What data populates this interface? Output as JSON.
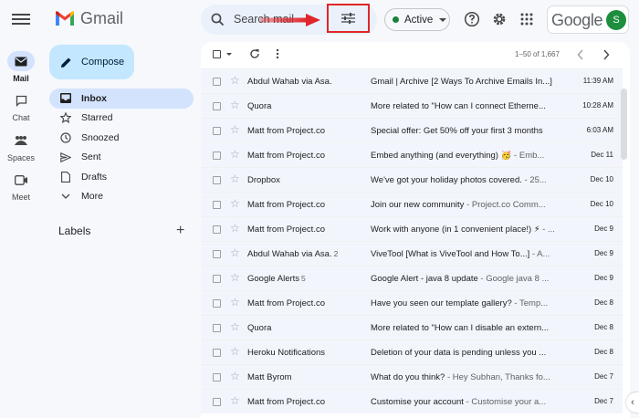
{
  "app": {
    "logo_text": "Gmail"
  },
  "rail": {
    "items": [
      {
        "label": "Mail",
        "icon": "mail-icon",
        "active": true
      },
      {
        "label": "Chat",
        "icon": "chat-icon",
        "active": false
      },
      {
        "label": "Spaces",
        "icon": "spaces-icon",
        "active": false
      },
      {
        "label": "Meet",
        "icon": "meet-icon",
        "active": false
      }
    ]
  },
  "search": {
    "placeholder": "Search mail"
  },
  "header": {
    "status_label": "Active",
    "status_color": "#188038",
    "google_logo_text": "Google",
    "avatar_initial": "S",
    "avatar_color": "#1e8e3e",
    "highlight_color": "#e0252b"
  },
  "sidebar": {
    "compose_label": "Compose",
    "items": [
      {
        "label": "Inbox",
        "icon": "inbox-icon",
        "active": true
      },
      {
        "label": "Starred",
        "icon": "star-icon",
        "active": false
      },
      {
        "label": "Snoozed",
        "icon": "clock-icon",
        "active": false
      },
      {
        "label": "Sent",
        "icon": "send-icon",
        "active": false
      },
      {
        "label": "Drafts",
        "icon": "draft-icon",
        "active": false
      },
      {
        "label": "More",
        "icon": "chevron-down-icon",
        "active": false
      }
    ],
    "labels_title": "Labels",
    "labels_add": "+"
  },
  "toolbar": {
    "pagination": "1–50 of 1,667"
  },
  "emails": [
    {
      "sender": "Abdul Wahab via Asa.",
      "count": "",
      "subject": "Gmail | Archive [2 Ways To Archive Emails In...]",
      "snippet": "",
      "date": "11:39 AM"
    },
    {
      "sender": "Quora",
      "count": "",
      "subject": "More related to \"How can I connect Etherne...",
      "snippet": "",
      "date": "10:28 AM"
    },
    {
      "sender": "Matt from Project.co",
      "count": "",
      "subject": "Special offer: Get 50% off your first 3 months",
      "snippet": "",
      "date": "6:03 AM"
    },
    {
      "sender": "Matt from Project.co",
      "count": "",
      "subject": "Embed anything (and everything) 🥳",
      "snippet": " - Emb...",
      "date": "Dec 11"
    },
    {
      "sender": "Dropbox",
      "count": "",
      "subject": "We've got your holiday photos covered.",
      "snippet": " - 25...",
      "date": "Dec 10"
    },
    {
      "sender": "Matt from Project.co",
      "count": "",
      "subject": "Join our new community",
      "snippet": " - Project.co Comm...",
      "date": "Dec 10"
    },
    {
      "sender": "Matt from Project.co",
      "count": "",
      "subject": "Work with anyone (in 1 convenient place!) ⚡",
      "snippet": " - ...",
      "date": "Dec 9"
    },
    {
      "sender": "Abdul Wahab via Asa.",
      "count": "2",
      "subject": "ViveTool [What is ViveTool and How To...]",
      "snippet": " - A...",
      "date": "Dec 9"
    },
    {
      "sender": "Google Alerts",
      "count": "5",
      "subject": "Google Alert - java 8 update",
      "snippet": " - Google java 8 ...",
      "date": "Dec 9"
    },
    {
      "sender": "Matt from Project.co",
      "count": "",
      "subject": "Have you seen our template gallery?",
      "snippet": " - Temp...",
      "date": "Dec 8"
    },
    {
      "sender": "Quora",
      "count": "",
      "subject": "More related to \"How can I disable an extern...",
      "snippet": "",
      "date": "Dec 8"
    },
    {
      "sender": "Heroku Notifications",
      "count": "",
      "subject": "Deletion of your data is pending unless you ...",
      "snippet": "",
      "date": "Dec 8"
    },
    {
      "sender": "Matt Byrom",
      "count": "",
      "subject": "What do you think?",
      "snippet": " - Hey Subhan, Thanks fo...",
      "date": "Dec 7"
    },
    {
      "sender": "Matt from Project.co",
      "count": "",
      "subject": "Customise your account",
      "snippet": " - Customise your a...",
      "date": "Dec 7"
    }
  ]
}
